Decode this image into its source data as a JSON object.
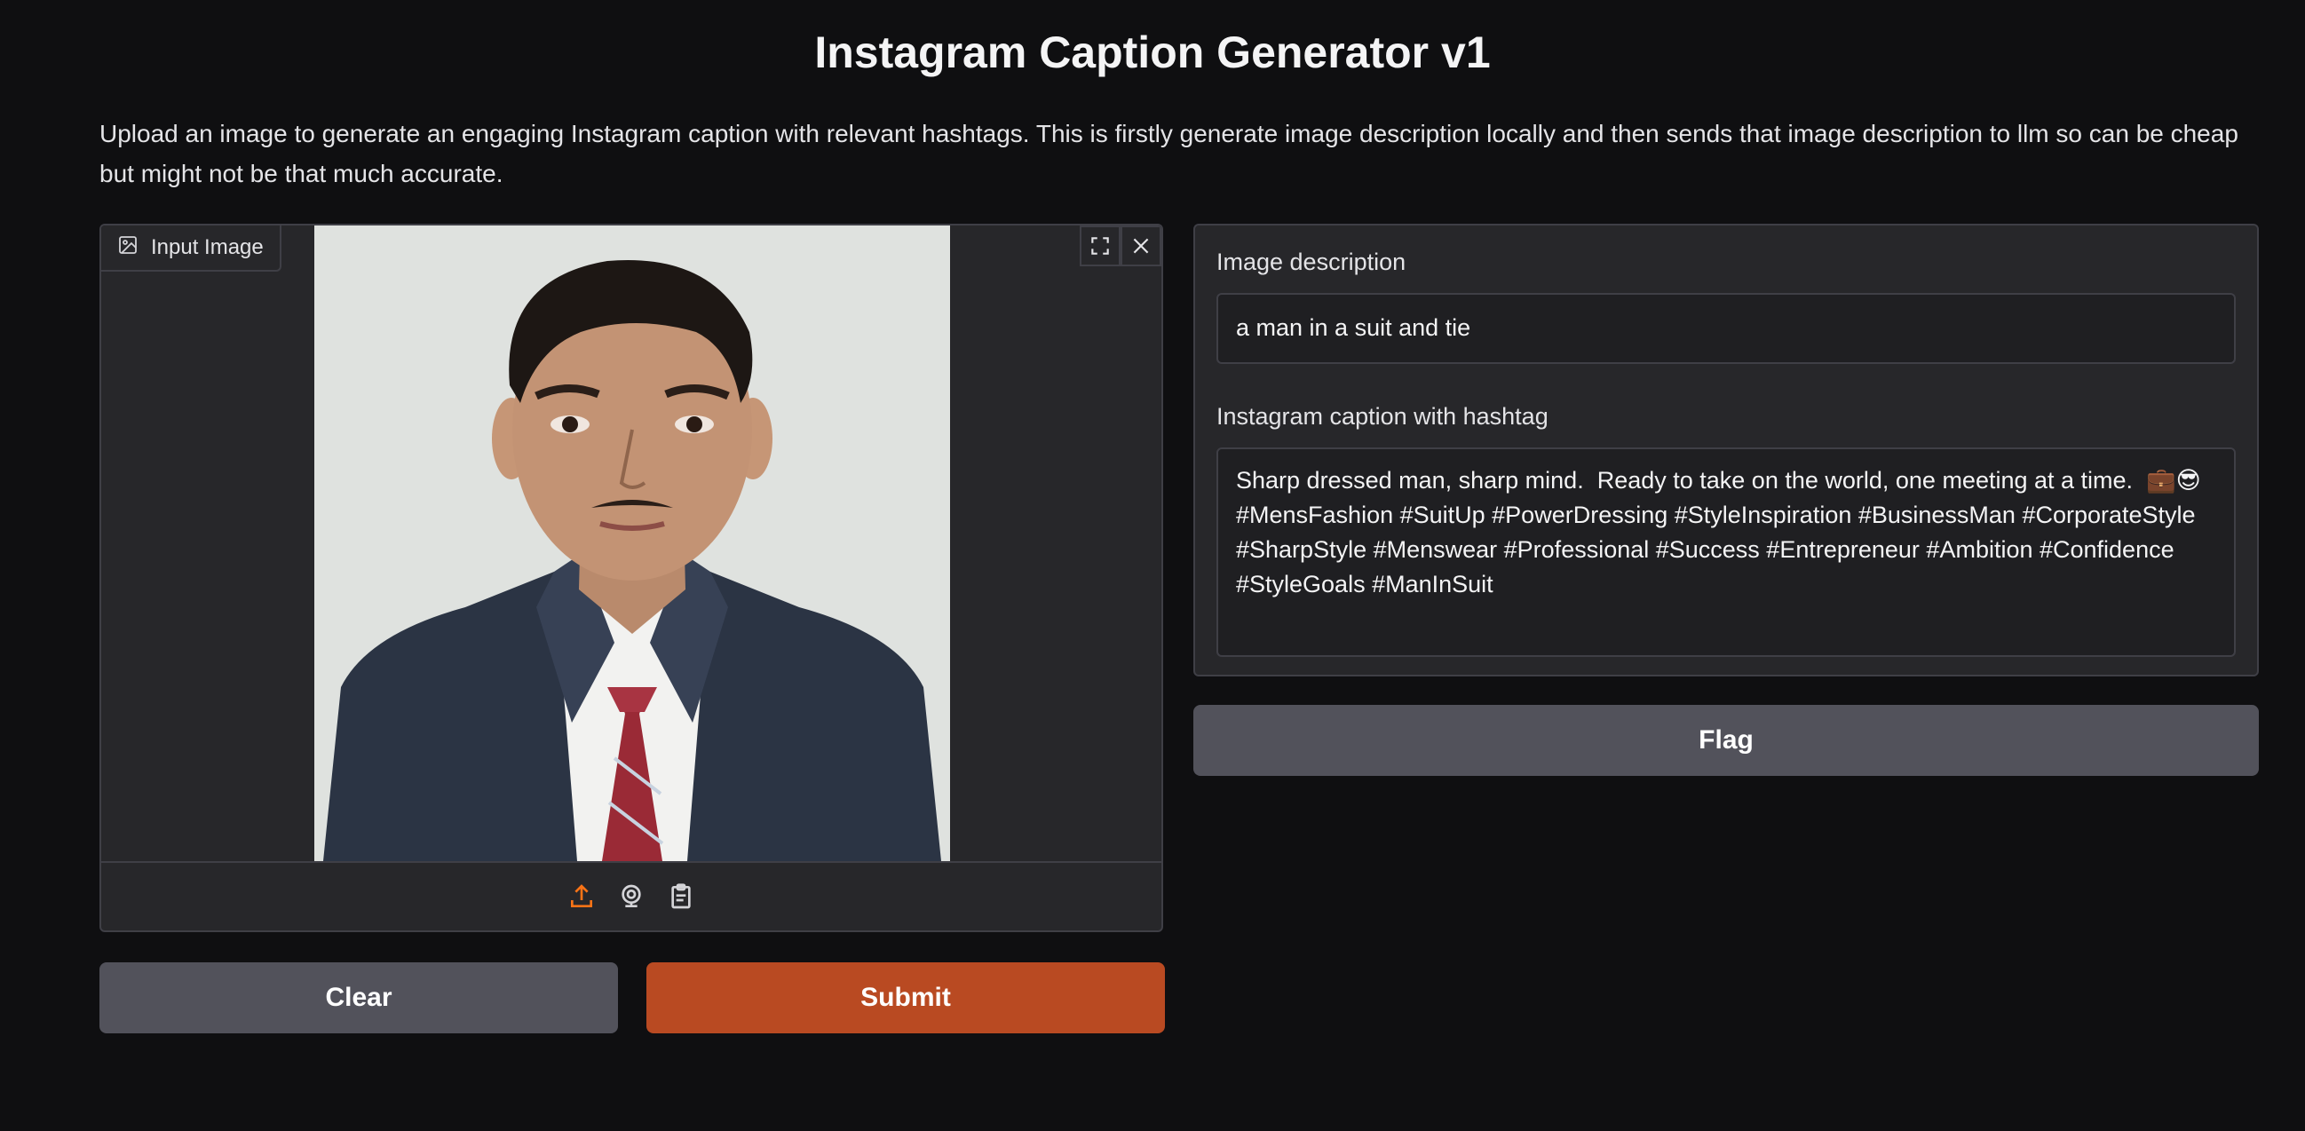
{
  "app": {
    "title": "Instagram Caption Generator v1",
    "description": "Upload an image to generate an engaging Instagram caption with relevant hashtags. This is firstly generate image description locally and then sends that image description to llm so can be cheap but might not be that much accurate."
  },
  "input_image": {
    "label": "Input Image",
    "label_icon": "image-icon",
    "tools": [
      "fullscreen-icon",
      "close-icon"
    ],
    "sources": [
      "upload-icon",
      "webcam-icon",
      "clipboard-icon"
    ]
  },
  "buttons": {
    "clear": "Clear",
    "submit": "Submit",
    "flag": "Flag"
  },
  "outputs": {
    "description_label": "Image description",
    "description_value": "a man in a suit and tie",
    "caption_label": "Instagram caption with hashtag",
    "caption_value": "Sharp dressed man, sharp mind.  Ready to take on the world, one meeting at a time.  💼😎\n#MensFashion #SuitUp #PowerDressing #StyleInspiration #BusinessMan #CorporateStyle\n#SharpStyle #Menswear #Professional #Success #Entrepreneur #Ambition #Confidence\n#StyleGoals #ManInSuit"
  },
  "colors": {
    "background": "#0f0f11",
    "panel": "#27272a",
    "accent": "#b94a22",
    "secondary_button": "#52525b",
    "upload_icon": "#f97316"
  }
}
